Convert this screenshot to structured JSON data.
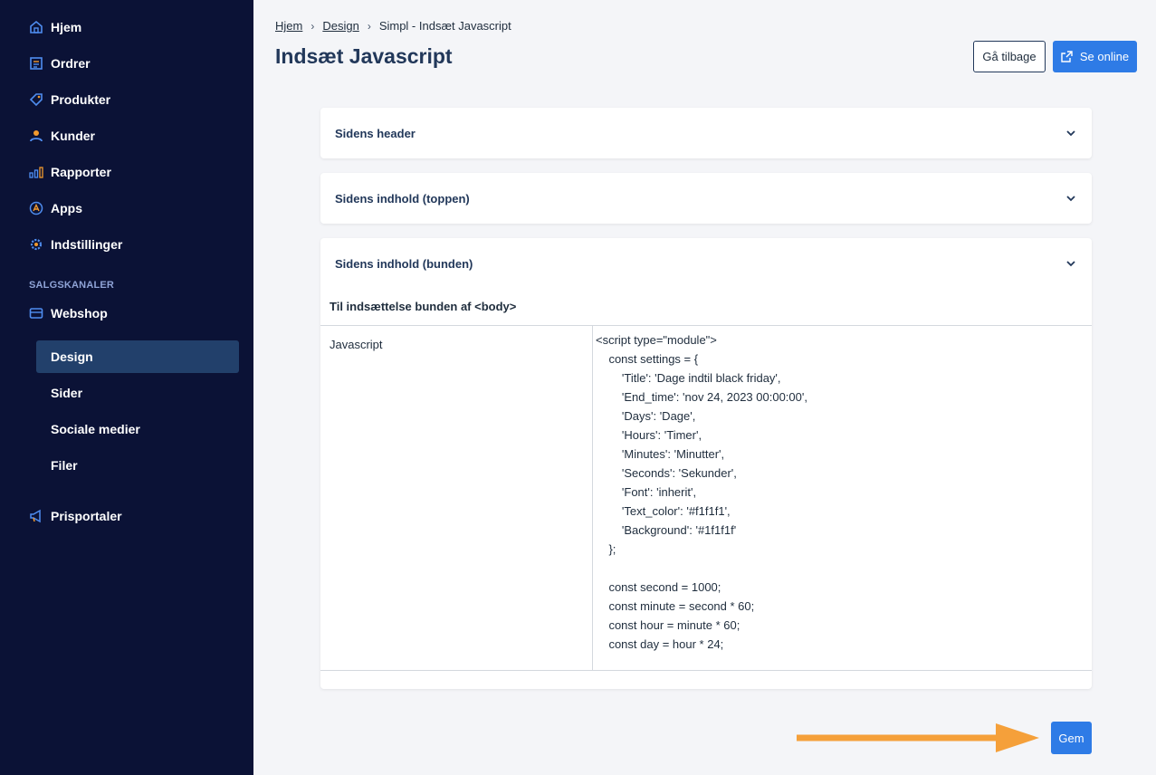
{
  "sidebar": {
    "items": [
      {
        "label": "Hjem",
        "icon": "home-icon"
      },
      {
        "label": "Ordrer",
        "icon": "orders-icon"
      },
      {
        "label": "Produkter",
        "icon": "tag-icon"
      },
      {
        "label": "Kunder",
        "icon": "user-icon"
      },
      {
        "label": "Rapporter",
        "icon": "bar-chart-icon"
      },
      {
        "label": "Apps",
        "icon": "apps-icon"
      },
      {
        "label": "Indstillinger",
        "icon": "gear-icon"
      }
    ],
    "section_label": "SALGSKANALER",
    "webshop": {
      "label": "Webshop",
      "icon": "storefront-icon"
    },
    "sub_items": [
      "Design",
      "Sider",
      "Sociale medier",
      "Filer"
    ],
    "prisportaler": {
      "label": "Prisportaler",
      "icon": "megaphone-icon"
    }
  },
  "breadcrumb": {
    "home": "Hjem",
    "design": "Design",
    "current": "Simpl - Indsæt Javascript"
  },
  "page_title": "Indsæt Javascript",
  "buttons": {
    "back": "Gå tilbage",
    "online": "Se online",
    "save": "Gem"
  },
  "accordion": {
    "header": "Sidens header",
    "content_top": "Sidens indhold (toppen)",
    "content_bottom": "Sidens indhold (bunden)"
  },
  "section": {
    "title": "Til indsættelse bunden af <body>",
    "label": "Javascript",
    "code": "<script type=\"module\">\n    const settings = {\n        'Title': 'Dage indtil black friday',\n        'End_time': 'nov 24, 2023 00:00:00',\n        'Days': 'Dage',\n        'Hours': 'Timer',\n        'Minutes': 'Minutter',\n        'Seconds': 'Sekunder',\n        'Font': 'inherit',\n        'Text_color': '#f1f1f1',\n        'Background': '#1f1f1f'\n    };\n\n    const second = 1000;\n    const minute = second * 60;\n    const hour = minute * 60;\n    const day = hour * 24;"
  },
  "colors": {
    "sidebar_bg": "#0b1236",
    "accent": "#2e7be6",
    "icon_orange": "#f29a2e",
    "arrow": "#f5a03a"
  }
}
